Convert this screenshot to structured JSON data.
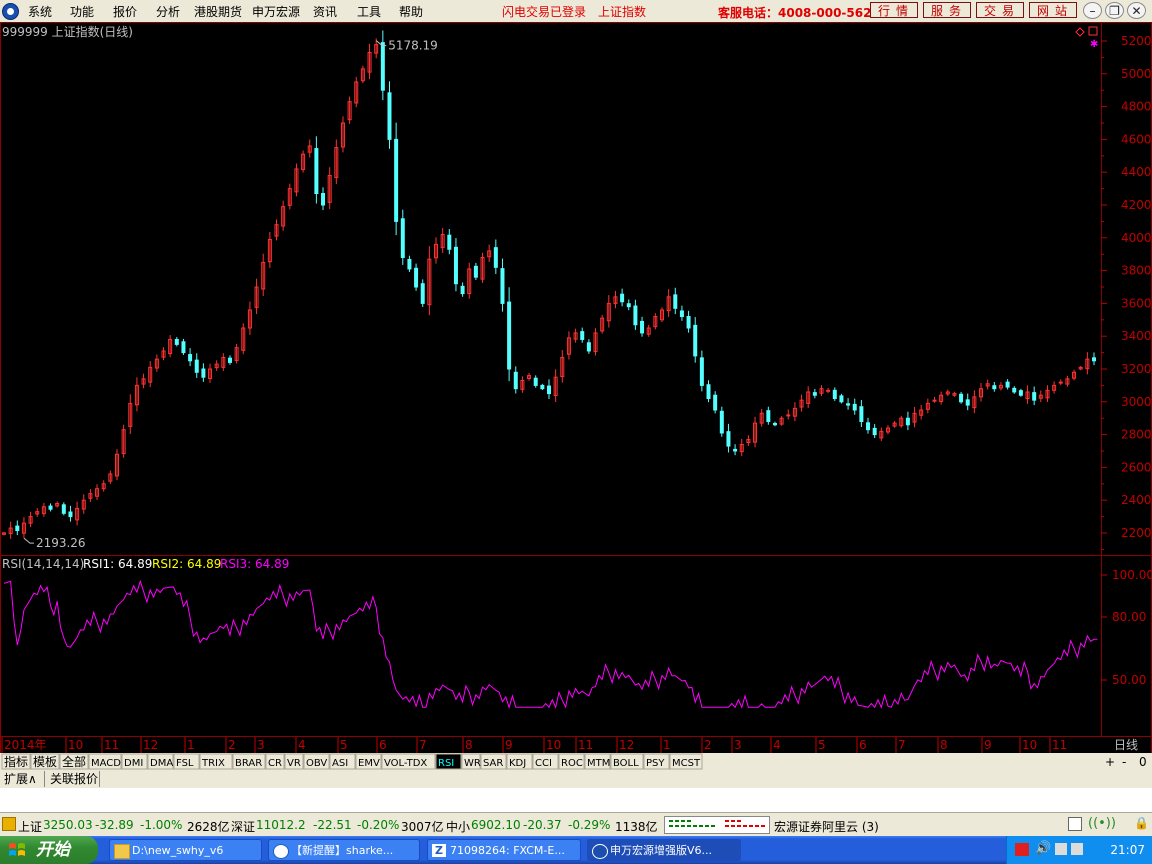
{
  "menu": {
    "items": [
      "系统",
      "功能",
      "报价",
      "分析",
      "港股期货",
      "申万宏源",
      "资讯",
      "工具",
      "帮助"
    ],
    "login_status": "闪电交易已登录",
    "index_name": "上证指数",
    "hotline": "客服电话：4008-000-562",
    "buttons": [
      "行情",
      "服务",
      "交易",
      "网站"
    ]
  },
  "chart_data": [
    {
      "type": "candlestick",
      "title": "999999 上证指数(日线)",
      "ylim": [
        2100,
        5300
      ],
      "y_ticks": [
        2200,
        2400,
        2600,
        2800,
        3000,
        3200,
        3400,
        3600,
        3800,
        4000,
        4200,
        4400,
        4600,
        4800,
        5000,
        5200
      ],
      "high_label": "5178.19",
      "low_label": "2193.26",
      "x_period_labels": [
        "2014年",
        "10",
        "11",
        "12",
        "1",
        "2",
        "3",
        "4",
        "5",
        "6",
        "7",
        "8",
        "9",
        "10",
        "11",
        "12",
        "1",
        "2",
        "3",
        "4",
        "5",
        "6",
        "7",
        "8",
        "9",
        "10",
        "11"
      ],
      "close_series": [
        2200,
        2230,
        2215,
        2260,
        2300,
        2330,
        2360,
        2345,
        2380,
        2320,
        2300,
        2350,
        2400,
        2440,
        2470,
        2500,
        2560,
        2680,
        2830,
        2990,
        3100,
        3140,
        3210,
        3260,
        3310,
        3380,
        3350,
        3300,
        3250,
        3180,
        3150,
        3200,
        3230,
        3270,
        3240,
        3330,
        3450,
        3560,
        3700,
        3850,
        3990,
        4080,
        4190,
        4300,
        4420,
        4510,
        4560,
        4270,
        4200,
        4380,
        4550,
        4700,
        4830,
        4950,
        5030,
        5130,
        5178,
        4900,
        4600,
        4100,
        3880,
        3810,
        3700,
        3600,
        3870,
        3960,
        4020,
        3930,
        3720,
        3660,
        3810,
        3760,
        3880,
        3920,
        3820,
        3600,
        3200,
        3080,
        3130,
        3160,
        3100,
        3080,
        3050,
        3150,
        3270,
        3390,
        3420,
        3380,
        3310,
        3420,
        3510,
        3600,
        3640,
        3610,
        3580,
        3470,
        3420,
        3450,
        3520,
        3560,
        3640,
        3570,
        3520,
        3450,
        3280,
        3100,
        3020,
        2950,
        2810,
        2730,
        2700,
        2740,
        2770,
        2870,
        2930,
        2880,
        2860,
        2900,
        2920,
        2960,
        3010,
        3060,
        3040,
        3080,
        3070,
        3020,
        3000,
        2980,
        2950,
        2880,
        2830,
        2800,
        2820,
        2840,
        2870,
        2900,
        2860,
        2930,
        2950,
        2990,
        3010,
        3040,
        3060,
        3050,
        3000,
        2980,
        3030,
        3080,
        3110,
        3080,
        3100,
        3090,
        3060,
        3040,
        3060,
        3010,
        3040,
        3070,
        3100,
        3120,
        3140,
        3180,
        3210,
        3260,
        3250
      ],
      "high_index": 56,
      "low_index": 3
    },
    {
      "type": "line",
      "title": "RSI(14,14,14)",
      "series_labels": [
        "RSI1: 64.89",
        "RSI2: 64.89",
        "RSI3: 64.89"
      ],
      "series_colors": [
        "#ffffff",
        "#ffff00",
        "#ff00ff"
      ],
      "ylim": [
        40,
        100
      ],
      "y_ticks": [
        50,
        80,
        100
      ]
    }
  ],
  "indicator_tabs": [
    "指标",
    "模板",
    "全部",
    "MACD",
    "DMI",
    "DMA",
    "FSL",
    "TRIX",
    "BRAR",
    "CR",
    "VR",
    "OBV",
    "ASI",
    "EMV",
    "VOL-TDX",
    "RSI",
    "WR",
    "SAR",
    "KDJ",
    "CCI",
    "ROC",
    "MTM",
    "BOLL",
    "PSY",
    "MCST"
  ],
  "active_tab": "RSI",
  "period": "日线",
  "bottom_tabs": [
    "扩展∧",
    "关联报价"
  ],
  "status": {
    "sh_label": "上证",
    "sh_value": "3250.03",
    "sh_change": "-32.89",
    "sh_pct": "-1.00%",
    "sh_amount": "2628亿",
    "sz_label": "深证",
    "sz_value": "11012.2",
    "sz_change": "-22.51",
    "sz_pct": "-0.20%",
    "sz_amount": "3007亿",
    "zx_label": "中小",
    "zx_value": "6902.10",
    "zx_change": "-20.37",
    "zx_pct": "-0.29%",
    "zx_amount": "1138亿",
    "server": "宏源证券阿里云 (3)"
  },
  "taskbar": {
    "start": "开始",
    "tasks": [
      "D:\\new_swhy_v6",
      "【新提醒】sharke...",
      "71098264: FXCM-E...",
      "申万宏源增强版V6..."
    ],
    "clock": "21:07"
  },
  "colors": {
    "up": "#ff3232",
    "down": "#54ffff",
    "grid": "#8b0000",
    "axis": "#c00000",
    "rsi": "#ff00ff"
  }
}
